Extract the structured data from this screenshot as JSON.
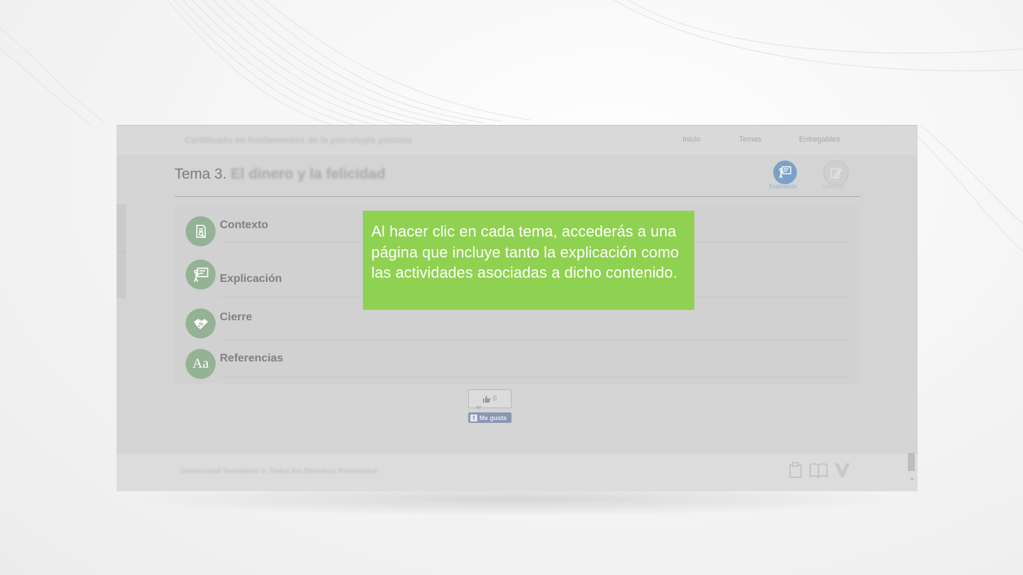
{
  "course": {
    "title": "Certificado en fundamentos de la psicología positiva"
  },
  "nav": {
    "items": [
      {
        "label": "Inicio"
      },
      {
        "label": "Temas"
      },
      {
        "label": "Entregables"
      }
    ]
  },
  "page": {
    "title_prefix": "Tema 3.",
    "title_rest": " El dinero y la felicidad"
  },
  "tools": {
    "explicacion": "Explicación",
    "actividad": "Actividad"
  },
  "sections": [
    {
      "label": "Contexto",
      "icon": "document-search-icon"
    },
    {
      "label": "Explicación",
      "icon": "presentation-board-icon"
    },
    {
      "label": "Cierre",
      "icon": "handshake-icon"
    },
    {
      "label": "Referencias",
      "icon": "font-aa-icon",
      "glyph": "Aa"
    }
  ],
  "like": {
    "count": "0",
    "button_label": "Me gusta"
  },
  "footer": {
    "text": "Universidad Tecmilenio ©. Todos los Derechos Reservados"
  },
  "callout": {
    "text": "Al hacer clic en cada tema, accederás a una página que incluye tanto la explicación como las actividades asociadas a dicho contenido."
  },
  "colors": {
    "callout_bg": "#8fd150",
    "section_icon": "#94b294",
    "tool_active": "#7aa2c6"
  }
}
